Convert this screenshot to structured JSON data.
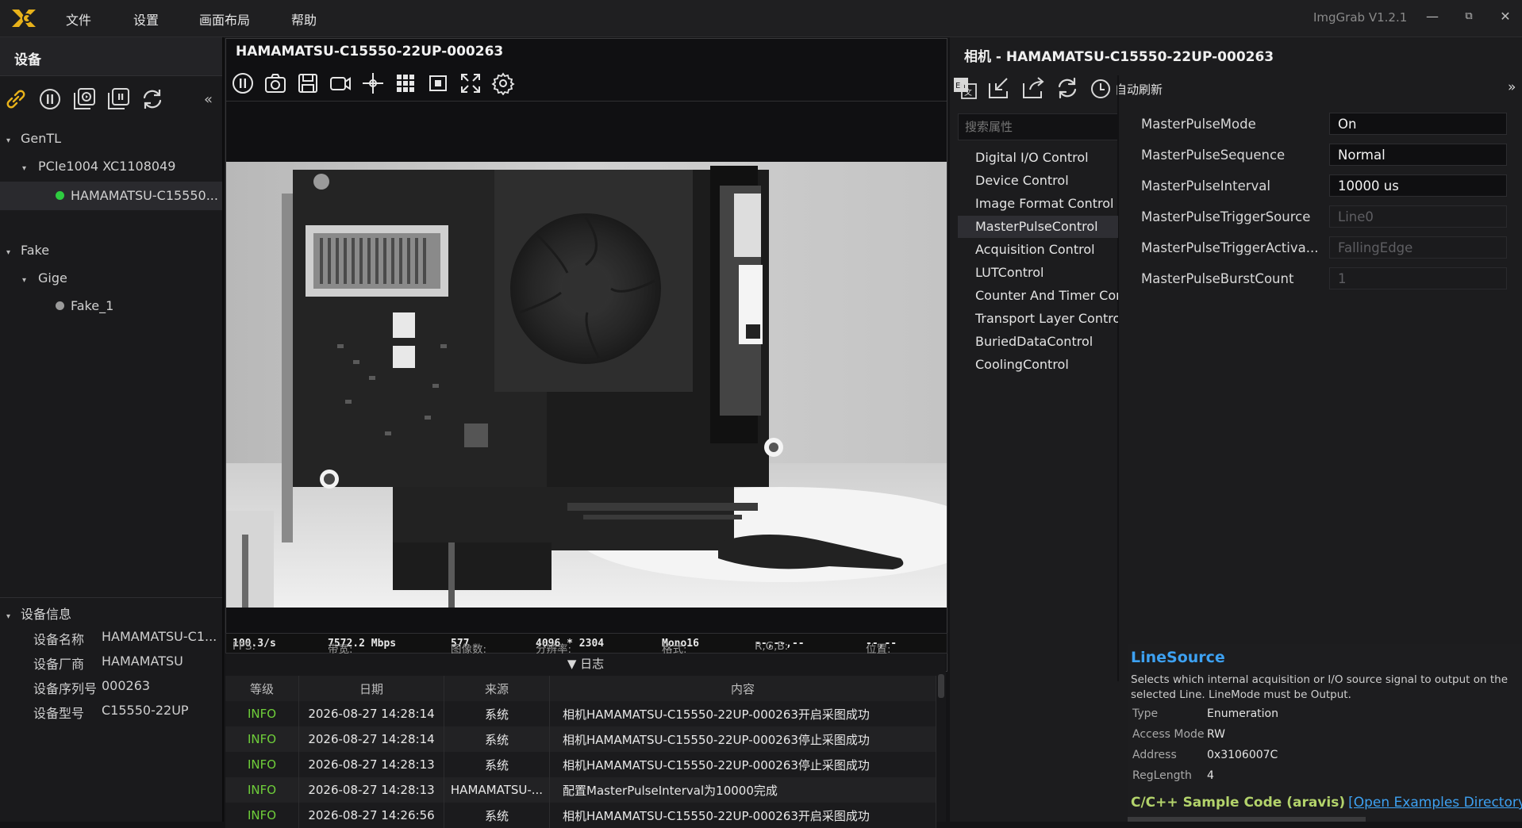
{
  "app": {
    "version": "ImgGrab V1.2.1"
  },
  "menu": [
    "文件",
    "设置",
    "画面布局",
    "帮助"
  ],
  "window_controls": {
    "minimize": "—",
    "restore": "⧉",
    "close": "✕"
  },
  "devices": {
    "title": "设备",
    "collapse": "«",
    "tree": [
      {
        "label": "GenTL",
        "level": 0,
        "expanded": true
      },
      {
        "label": "PCIe1004 XC1108049",
        "level": 1,
        "expanded": true
      },
      {
        "label": "HAMAMATSU-C15550...",
        "level": 2,
        "status": "connected",
        "status_color": "#2ecc40"
      },
      {
        "label": "Fake",
        "level": 0,
        "expanded": true
      },
      {
        "label": "Gige",
        "level": 1,
        "expanded": true
      },
      {
        "label": "Fake_1",
        "level": 2,
        "status": "offline",
        "status_color": "#9a9a9a"
      }
    ]
  },
  "device_info": {
    "title": "设备信息",
    "rows": [
      {
        "label": "设备名称",
        "value": "HAMAMATSU-C1..."
      },
      {
        "label": "设备厂商",
        "value": "HAMAMATSU"
      },
      {
        "label": "设备序列号",
        "value": "000263"
      },
      {
        "label": "设备型号",
        "value": "C15550-22UP"
      }
    ]
  },
  "viewer": {
    "title": "HAMAMATSU-C15550-22UP-000263",
    "toolbar": [
      "pause-icon",
      "snapshot-icon",
      "save-icon",
      "record-icon",
      "crosshair-icon",
      "grid-icon",
      "roi-icon",
      "fullscreen-icon",
      "settings-icon"
    ],
    "status": {
      "fps_label": "FPS:",
      "fps": "100.3/s",
      "bw_label": "带宽:",
      "bw": "7572.2 Mbps",
      "frames_label": "图像数:",
      "frames": "577",
      "res_label": "分辨率:",
      "res": "4096 * 2304",
      "fmt_label": "格式:",
      "fmt": "Mono16",
      "rgb_label": "R,G,B:",
      "rgb": "--,--,--",
      "pos_label": "位置:",
      "pos": "--,--"
    }
  },
  "log": {
    "title": "▼  日志",
    "columns": [
      "等级",
      "日期",
      "来源",
      "内容"
    ],
    "rows": [
      {
        "level": "INFO",
        "date": "2026-08-27 14:28:14",
        "source": "系统",
        "content": "相机HAMAMATSU-C15550-22UP-000263开启采图成功"
      },
      {
        "level": "INFO",
        "date": "2026-08-27 14:28:14",
        "source": "系统",
        "content": "相机HAMAMATSU-C15550-22UP-000263停止采图成功"
      },
      {
        "level": "INFO",
        "date": "2026-08-27 14:28:13",
        "source": "系统",
        "content": "相机HAMAMATSU-C15550-22UP-000263停止采图成功"
      },
      {
        "level": "INFO",
        "date": "2026-08-27 14:28:13",
        "source": "HAMAMATSU-...",
        "content": "配置MasterPulseInterval为10000完成"
      },
      {
        "level": "INFO",
        "date": "2026-08-27 14:26:56",
        "source": "系统",
        "content": "相机HAMAMATSU-C15550-22UP-000263开启采图成功"
      }
    ]
  },
  "camera": {
    "title": "相机 - HAMAMATSU-C15550-22UP-000263",
    "auto_refresh": "自动刷新",
    "expand": "»",
    "search_placeholder": "搜索属性",
    "categories": [
      "Digital I/O Control",
      "Device Control",
      "Image Format Control",
      "MasterPulseControl",
      "Acquisition Control",
      "LUTControl",
      "Counter And Timer Control",
      "Transport Layer Control",
      "BuriedDataControl",
      "CoolingControl"
    ],
    "selected_category": "MasterPulseControl",
    "properties": [
      {
        "name": "MasterPulseMode",
        "value": "On",
        "enabled": true
      },
      {
        "name": "MasterPulseSequence",
        "value": "Normal",
        "enabled": true
      },
      {
        "name": "MasterPulseInterval",
        "value": "10000 us",
        "enabled": true
      },
      {
        "name": "MasterPulseTriggerSource",
        "value": "Line0",
        "enabled": false
      },
      {
        "name": "MasterPulseTriggerActiva...",
        "value": "FallingEdge",
        "enabled": false
      },
      {
        "name": "MasterPulseBurstCount",
        "value": "1",
        "enabled": false
      }
    ]
  },
  "description": {
    "title": "LineSource",
    "text": "Selects which internal acquisition or I/O source signal to output on the selected Line. LineMode must be Output.",
    "fields": [
      {
        "key": "Type",
        "value": "Enumeration"
      },
      {
        "key": "Access Mode",
        "value": "RW"
      },
      {
        "key": "Address",
        "value": "0x3106007C"
      },
      {
        "key": "RegLength",
        "value": "4"
      }
    ],
    "code_label": "C/C++ Sample Code (aravis)",
    "code_link": "[Open Examples Directory]"
  }
}
